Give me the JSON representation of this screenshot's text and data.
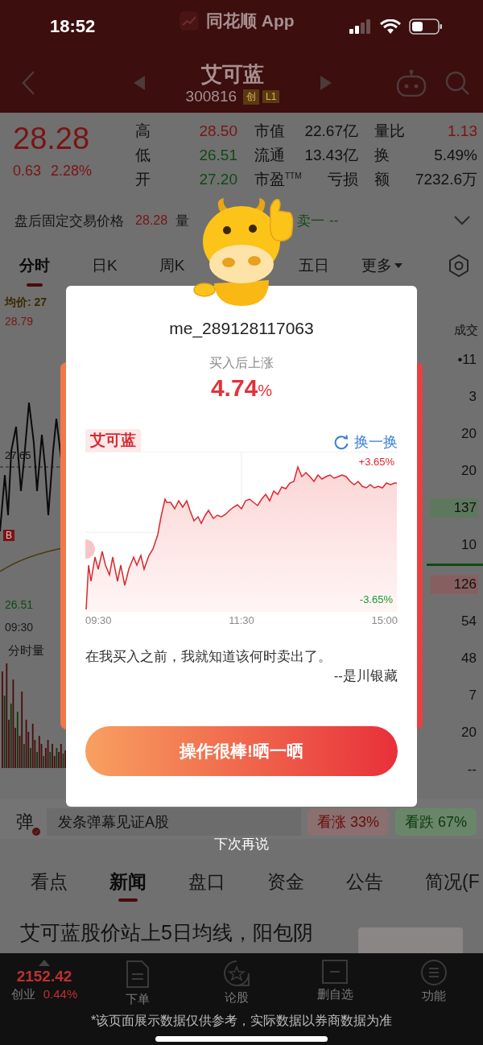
{
  "status_bar": {
    "time": "18:52",
    "app_label": "同花顺 App"
  },
  "header": {
    "title": "艾可蓝",
    "code": "300816",
    "tags": [
      "创",
      "L1"
    ]
  },
  "quote": {
    "price": "28.28",
    "change": "0.63",
    "change_pct": "2.28%",
    "color": "#7a1414",
    "stat_columns": [
      {
        "items": [
          {
            "label": "高",
            "value": "28.50",
            "color": "#7a1414"
          },
          {
            "label": "低",
            "value": "26.51",
            "color": "#0f4a14"
          },
          {
            "label": "开",
            "value": "27.20",
            "color": "#0f4a14"
          }
        ]
      },
      {
        "items": [
          {
            "label": "市值",
            "value": "22.67亿",
            "color": "#111111"
          },
          {
            "label": "流通",
            "value": "13.43亿",
            "color": "#111111"
          },
          {
            "label": "市盈$^{TTM}$",
            "value": "亏损",
            "color": "#111111"
          }
        ]
      },
      {
        "items": [
          {
            "label": "量比",
            "value": "1.13",
            "color": "#7a1414"
          },
          {
            "label": "换",
            "value": "5.49%",
            "color": "#111111"
          },
          {
            "label": "额",
            "value": "7232.6万",
            "color": "#111111"
          }
        ]
      }
    ]
  },
  "after_hours": {
    "label": "盘后固定交易价格",
    "price": "28.28",
    "volume_label": "量",
    "ask_label": "卖一",
    "ask_value": "--"
  },
  "chart_tabs": [
    {
      "label": "分时",
      "selected": true
    },
    {
      "label": "日K",
      "selected": false
    },
    {
      "label": "周K",
      "selected": false
    },
    {
      "label": "五日",
      "selected": false
    }
  ],
  "more_menu": {
    "label": "更多"
  },
  "intraday": {
    "avg_label": "均价: 27",
    "high": "28.79",
    "reference": "27.65",
    "low": "26.51",
    "start_time": "09:30",
    "volume_label": "分时量",
    "buy_marker": "B"
  },
  "trades": {
    "header": "成交",
    "asks": [
      {
        "value": "•11",
        "highlight": false
      },
      {
        "value": "3",
        "highlight": false
      },
      {
        "value": "20",
        "highlight": false
      },
      {
        "value": "20",
        "highlight": false
      },
      {
        "value": "137",
        "highlight": true
      },
      {
        "value": "10",
        "highlight": false
      }
    ],
    "bids": [
      {
        "value": "126",
        "highlight": true
      },
      {
        "value": "54",
        "highlight": false
      },
      {
        "value": "48",
        "highlight": false
      },
      {
        "value": "7",
        "highlight": false
      },
      {
        "value": "20",
        "highlight": false
      },
      {
        "value": "--",
        "highlight": false
      }
    ]
  },
  "danmaku": {
    "icon_label": "弹",
    "placeholder": "发条弹幕见证A股",
    "bull": "看涨 33%",
    "bear": "看跌 67%"
  },
  "news_tabs": [
    {
      "label": "看点",
      "selected": false
    },
    {
      "label": "新闻",
      "selected": true
    },
    {
      "label": "盘口",
      "selected": false
    },
    {
      "label": "资金",
      "selected": false
    },
    {
      "label": "公告",
      "selected": false
    },
    {
      "label": "简况(F",
      "selected": false
    }
  ],
  "headline": "艾可蓝股价站上5日均线，阳包阴",
  "bottom_bar": {
    "index_value": "2152.42",
    "index_name": "创业",
    "index_change": "0.44%",
    "items": [
      {
        "kind": "order",
        "label": "下单"
      },
      {
        "kind": "discuss",
        "label": "论股"
      },
      {
        "kind": "unwatch",
        "label": "删自选"
      },
      {
        "kind": "menu",
        "label": "功能"
      }
    ]
  },
  "disclaimer": "*该页面展示数据仅供参考，实际数据以券商数据为准",
  "popup": {
    "username": "me_289128117063",
    "subtitle": "买入后上涨",
    "gain": "4.74",
    "gain_unit": "%",
    "stock_tag": "艾可蓝",
    "refresh_label": "换一换",
    "chart": {
      "top_label": "+3.65%",
      "bottom_label": "-3.65%",
      "times": [
        "09:30",
        "11:30",
        "15:00"
      ]
    },
    "quote": "在我买入之前，我就知道该何时卖出了。",
    "author": "--是川银藏",
    "button": "操作很棒!晒一晒"
  },
  "dismiss": "下次再说"
}
